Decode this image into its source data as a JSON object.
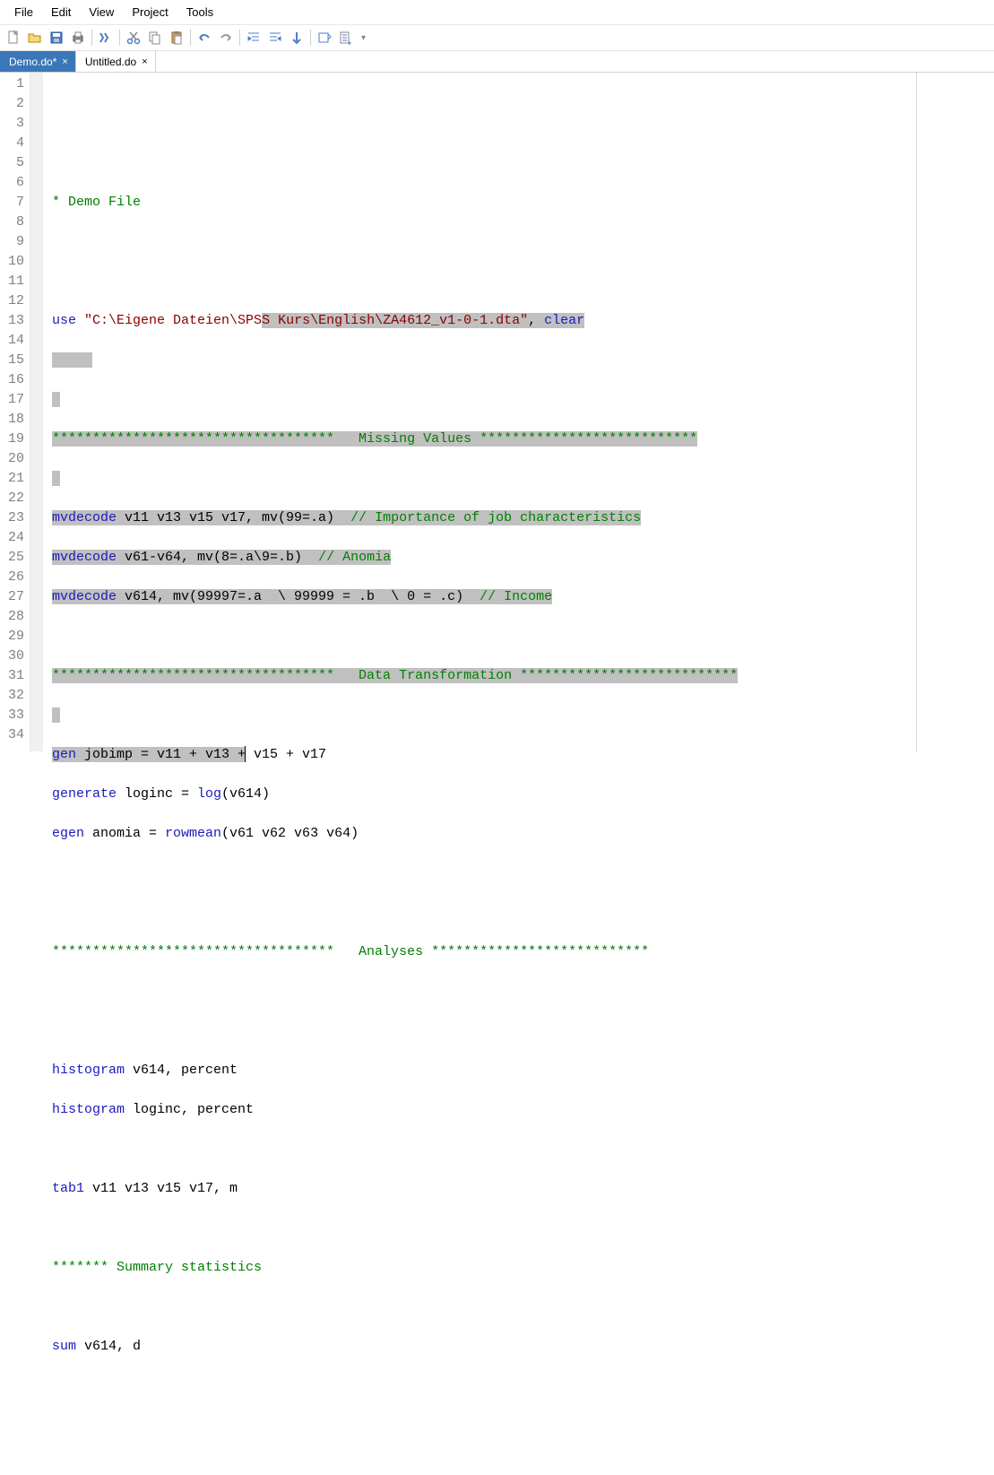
{
  "menu": {
    "file": "File",
    "edit": "Edit",
    "view": "View",
    "project": "Project",
    "tools": "Tools"
  },
  "tabs": [
    {
      "label": "Demo.do*",
      "active": true
    },
    {
      "label": "Untitled.do",
      "active": false
    }
  ],
  "gutter": [
    "1",
    "2",
    "3",
    "4",
    "5",
    "6",
    "7",
    "8",
    "9",
    "10",
    "11",
    "12",
    "13",
    "14",
    "15",
    "16",
    "17",
    "18",
    "19",
    "20",
    "21",
    "22",
    "23",
    "24",
    "25",
    "26",
    "27",
    "28",
    "29",
    "30",
    "31",
    "32",
    "33",
    "34"
  ],
  "code": {
    "l3_cmt": "* Demo File",
    "l6_kw": "use",
    "l6_str1": "\"C:\\Eigene Dateien\\SPS",
    "l6_str2": "S Kurs\\English\\ZA4612_v1-0-1.dta\"",
    "l6_rest": ", ",
    "l6_kw2": "clear",
    "l7_sel": "     ",
    "l9_cmt": "***********************************   Missing Values ***************************",
    "l11_kw": "mvdecode",
    "l11_txt": " v11 v13 v15 v17, mv(99=.a)  ",
    "l11_cmt": "// Importance of job characteristics",
    "l12_kw": "mvdecode",
    "l12_txt": " v61-v64, mv(8=.a\\9=.b)  ",
    "l12_cmt": "// Anomia",
    "l13_kw": "mvdecode",
    "l13_txt": " v614, mv(99997=.a  \\ 99999 = .b  \\ 0 = .c)  ",
    "l13_cmt": "// Income",
    "l15_cmt": "***********************************   Data Transformation ***************************",
    "l17_kw": "gen",
    "l17_txt_sel": " jobimp = v11 + v13 +",
    "l17_txt_rest": " v15 + v17",
    "l18_kw": "generate",
    "l18_txt1": " loginc = ",
    "l18_fn": "log",
    "l18_txt2": "(v614)",
    "l19_kw": "egen",
    "l19_txt1": " anomia = ",
    "l19_fn": "rowmean",
    "l19_txt2": "(v61 v62 v63 v64)",
    "l22_cmt": "***********************************   Analyses ***************************",
    "l25_kw": "histogram",
    "l25_txt": " v614, percent",
    "l26_kw": "histogram",
    "l26_txt": " loginc, percent",
    "l28_kw": "tab1",
    "l28_txt": " v11 v13 v15 v17, m",
    "l30_cmt": "******* Summary statistics",
    "l32_kw": "sum",
    "l32_txt": " v614, d"
  }
}
